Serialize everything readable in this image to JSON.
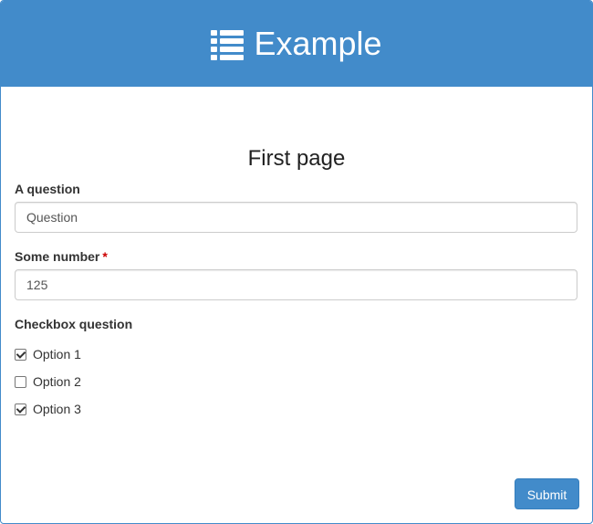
{
  "header": {
    "icon": "list-icon",
    "title": "Example"
  },
  "page": {
    "title": "First page"
  },
  "fields": {
    "question": {
      "label": "A question",
      "value": "Question"
    },
    "number": {
      "label": "Some number",
      "required_mark": "*",
      "value": "125"
    },
    "checkbox": {
      "label": "Checkbox question",
      "options": [
        {
          "label": "Option 1",
          "checked": true
        },
        {
          "label": "Option 2",
          "checked": false
        },
        {
          "label": "Option 3",
          "checked": true
        }
      ]
    }
  },
  "actions": {
    "submit_label": "Submit"
  },
  "colors": {
    "primary": "#428bca",
    "required": "#cc0000"
  }
}
